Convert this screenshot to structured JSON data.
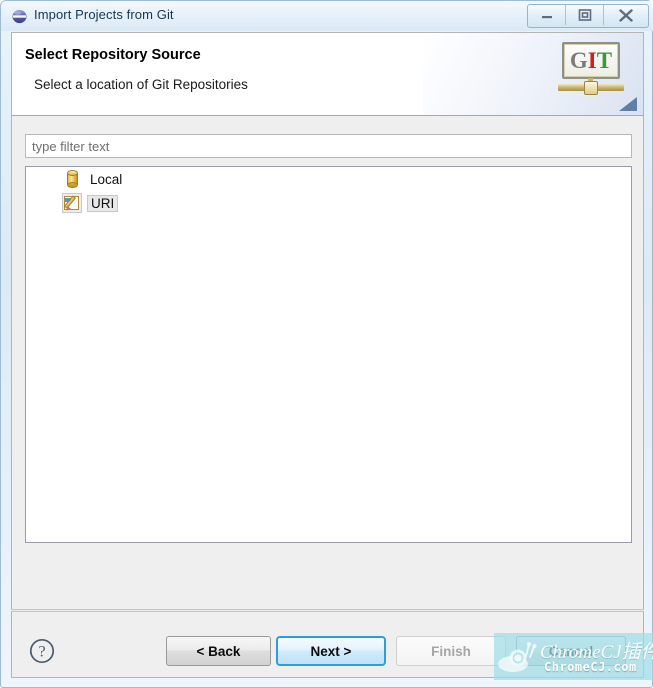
{
  "window": {
    "title": "Import Projects from Git",
    "app_icon": "eclipse-sphere-icon",
    "controls": {
      "minimize": "minimize-icon",
      "restore": "restore-icon",
      "close": "close-icon"
    }
  },
  "header": {
    "title": "Select Repository Source",
    "subtitle": "Select a location of Git Repositories",
    "logo": {
      "name": "git-logo",
      "letters": [
        "G",
        "I",
        "T"
      ],
      "colors": {
        "g": "#7b7b7b",
        "i": "#d21f1f",
        "t": "#3a9a3a",
        "bar": "#cfb871"
      }
    }
  },
  "filter": {
    "placeholder": "type filter text",
    "value": ""
  },
  "tree": {
    "items": [
      {
        "label": "Local",
        "icon": "database-cylinder-icon",
        "selected": false
      },
      {
        "label": "URI",
        "icon": "page-pencil-edit-icon",
        "selected": true
      }
    ]
  },
  "footer": {
    "help": "help-icon",
    "buttons": {
      "back": {
        "label": "< Back",
        "enabled": true,
        "default": false
      },
      "next": {
        "label": "Next >",
        "enabled": true,
        "default": true
      },
      "finish": {
        "label": "Finish",
        "enabled": false,
        "default": false
      },
      "cancel": {
        "label": "Cancel",
        "enabled": true,
        "default": false
      }
    }
  },
  "watermark": {
    "brand": "ChromeCJ插件",
    "url": "ChromeCJ.com",
    "icon": "snail-icon",
    "color": "#a0dee8"
  }
}
